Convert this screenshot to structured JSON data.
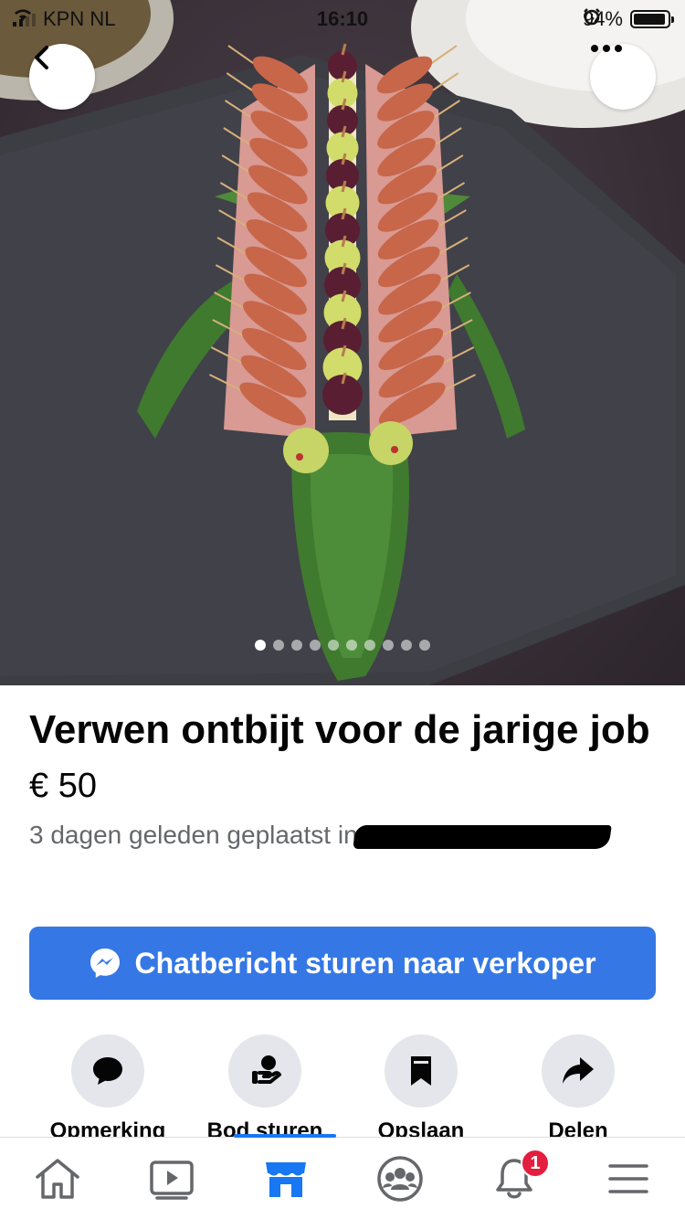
{
  "status_bar": {
    "carrier": "KPN NL",
    "time": "16:10",
    "battery_percent": "94%",
    "battery_level": 0.94
  },
  "photo": {
    "slide_count": 10,
    "active_index": 0
  },
  "listing": {
    "title": "Verwen ontbijt voor de jarige job",
    "price": "€ 50",
    "posted": "3 dagen geleden geplaatst in"
  },
  "cta": {
    "label": "Chatbericht sturen naar verkoper",
    "icon": "messenger-icon",
    "color": "#3578e5"
  },
  "actions": [
    {
      "label": "Opmerking",
      "icon": "comment-icon"
    },
    {
      "label": "Bod sturen",
      "icon": "offer-icon"
    },
    {
      "label": "Opslaan",
      "icon": "bookmark-icon"
    },
    {
      "label": "Delen",
      "icon": "share-icon"
    }
  ],
  "tabbar": {
    "items": [
      {
        "name": "home",
        "icon": "home-icon"
      },
      {
        "name": "watch",
        "icon": "video-icon"
      },
      {
        "name": "marketplace",
        "icon": "marketplace-icon",
        "active": true
      },
      {
        "name": "groups",
        "icon": "groups-icon"
      },
      {
        "name": "notifications",
        "icon": "bell-icon",
        "badge": "1"
      },
      {
        "name": "menu",
        "icon": "menu-icon"
      }
    ],
    "accent": "#1877f2"
  }
}
